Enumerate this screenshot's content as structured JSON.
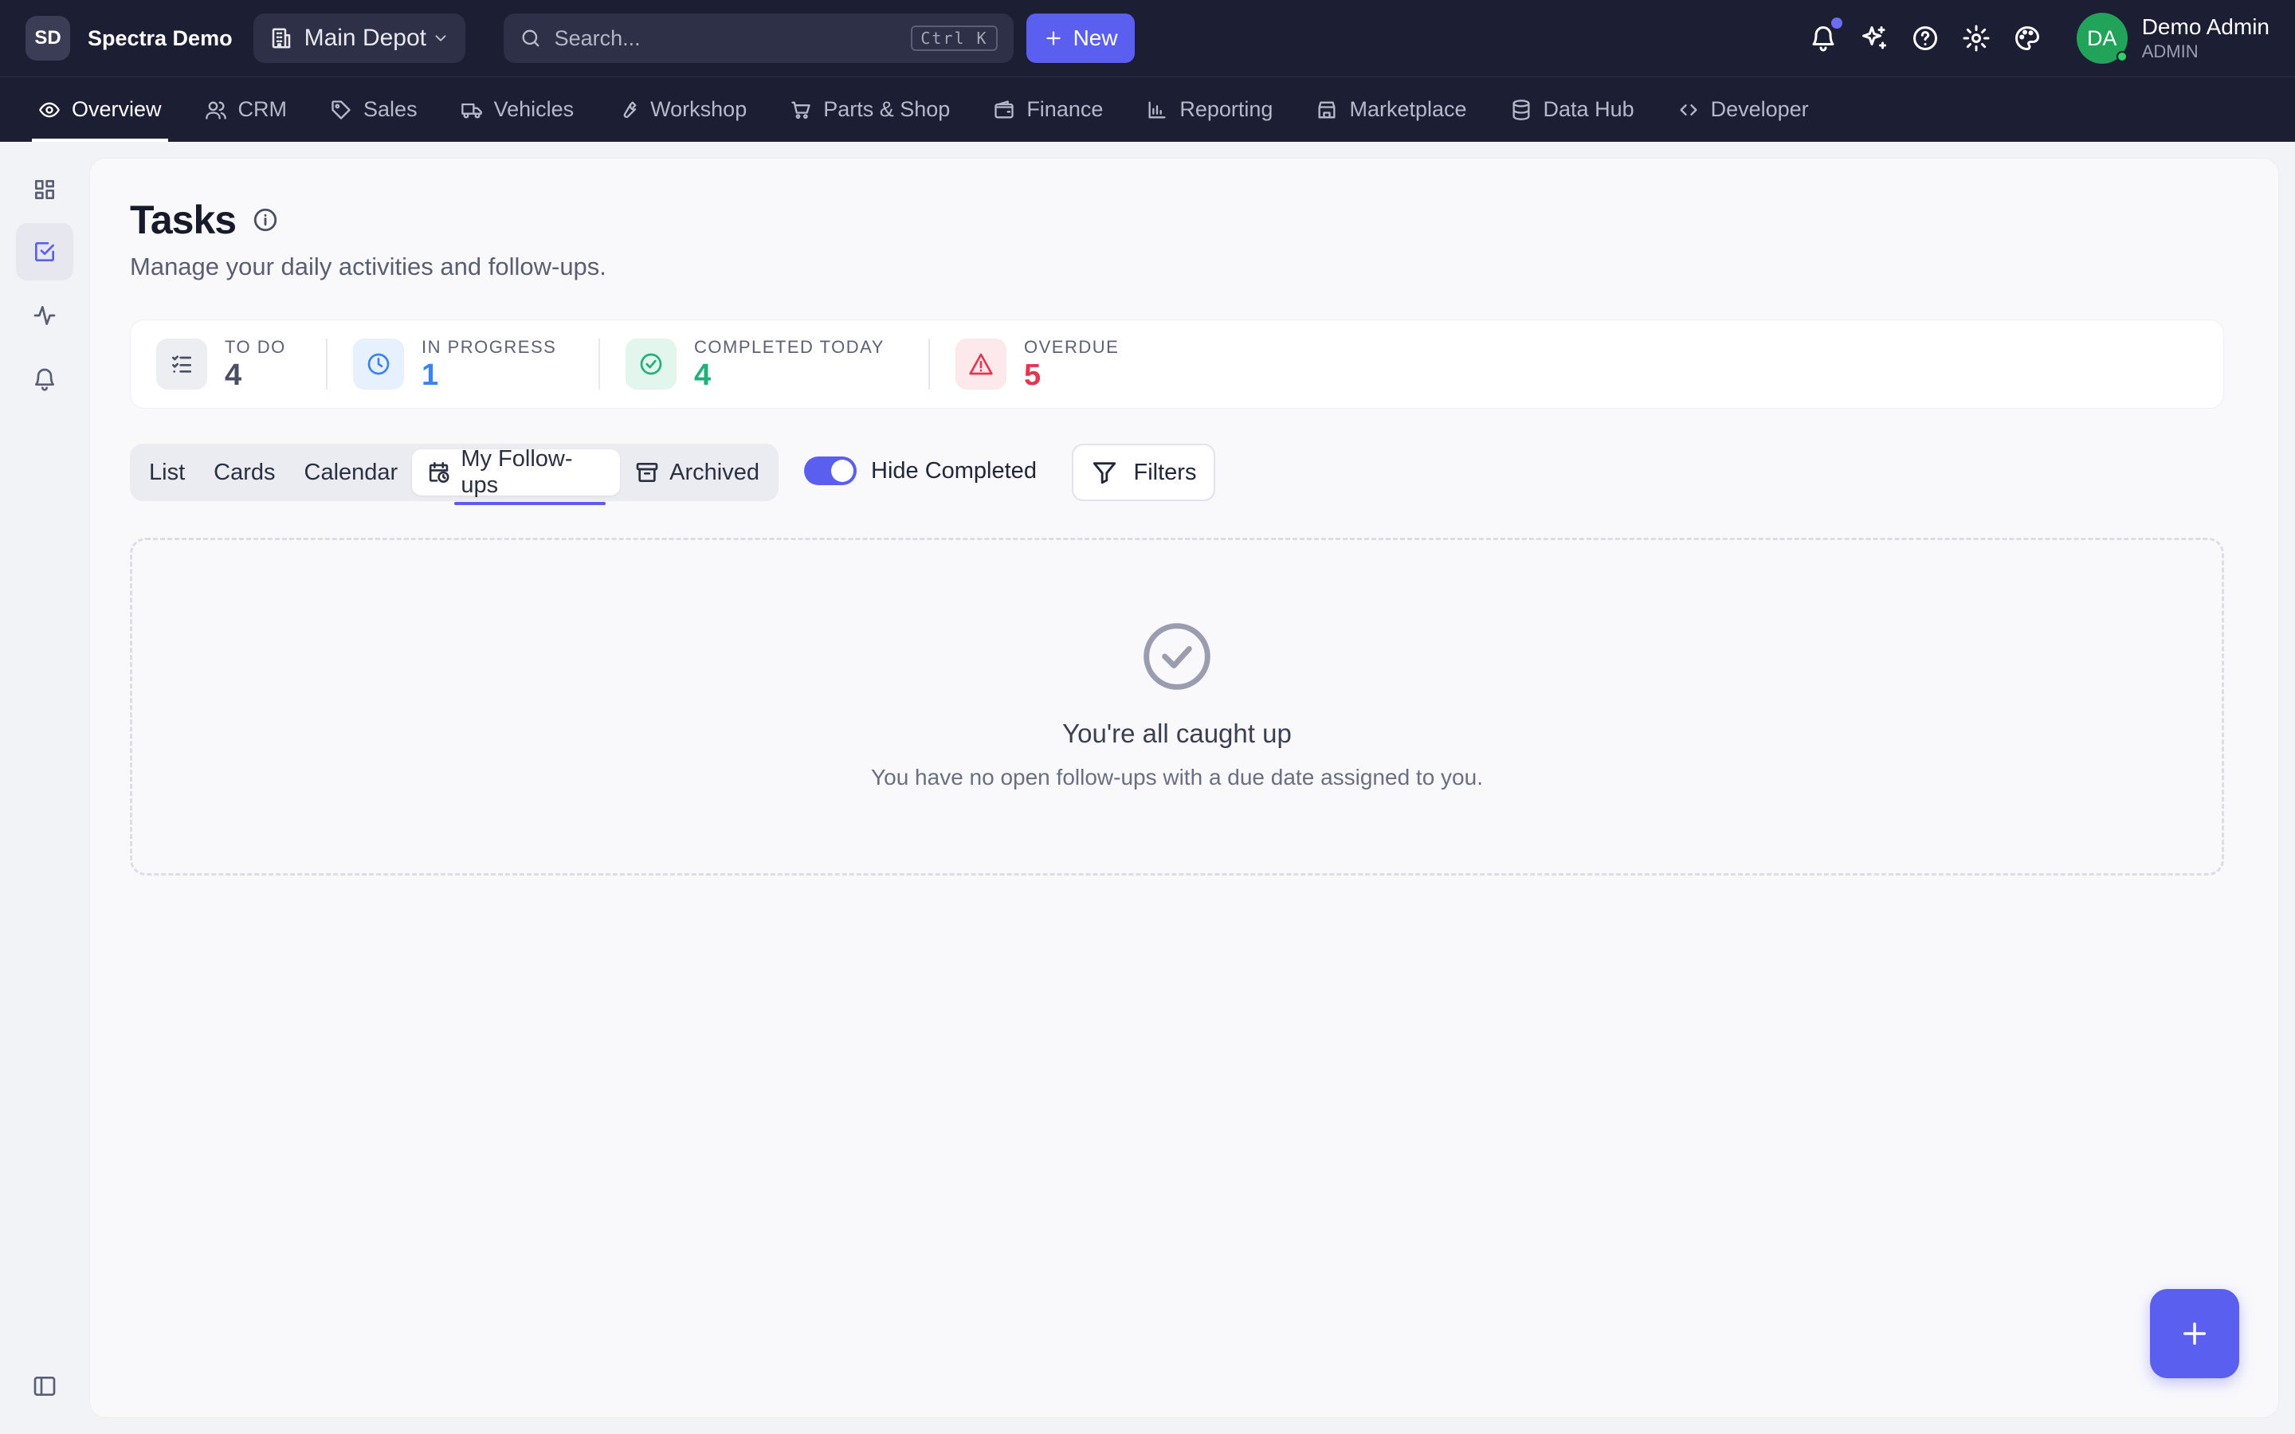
{
  "app": {
    "brand_initials": "SD",
    "brand_name": "Spectra Demo",
    "location": "Main Depot",
    "search_placeholder": "Search...",
    "search_shortcut": "Ctrl K",
    "new_label": "New"
  },
  "user": {
    "initials": "DA",
    "name": "Demo Admin",
    "role": "ADMIN"
  },
  "nav": {
    "items": [
      {
        "label": "Overview",
        "icon": "eye-icon",
        "active": true
      },
      {
        "label": "CRM",
        "icon": "users-icon"
      },
      {
        "label": "Sales",
        "icon": "tag-icon"
      },
      {
        "label": "Vehicles",
        "icon": "truck-icon"
      },
      {
        "label": "Workshop",
        "icon": "wrench-icon"
      },
      {
        "label": "Parts & Shop",
        "icon": "cart-icon"
      },
      {
        "label": "Finance",
        "icon": "wallet-icon"
      },
      {
        "label": "Reporting",
        "icon": "bar-chart-icon"
      },
      {
        "label": "Marketplace",
        "icon": "store-icon"
      },
      {
        "label": "Data Hub",
        "icon": "database-icon"
      },
      {
        "label": "Developer",
        "icon": "code-icon"
      }
    ]
  },
  "page": {
    "title": "Tasks",
    "subtitle": "Manage your daily activities and follow-ups."
  },
  "stats": [
    {
      "label": "TO DO",
      "value": "4",
      "color": "#4a4e63",
      "bg": "#eceef2",
      "icon": "list-check-icon"
    },
    {
      "label": "IN PROGRESS",
      "value": "1",
      "color": "#3b82f6",
      "bg": "#e7f0fd",
      "icon": "clock-icon"
    },
    {
      "label": "COMPLETED TODAY",
      "value": "4",
      "color": "#22b07a",
      "bg": "#e3f6ee",
      "icon": "check-circle-icon"
    },
    {
      "label": "OVERDUE",
      "value": "5",
      "color": "#e5364f",
      "bg": "#fde8eb",
      "icon": "alert-triangle-icon"
    }
  ],
  "view_tabs": {
    "list": "List",
    "cards": "Cards",
    "calendar": "Calendar",
    "followups": "My Follow-ups",
    "archived": "Archived",
    "selected": "My Follow-ups"
  },
  "hide_completed": {
    "label": "Hide Completed",
    "on": true
  },
  "filters_label": "Filters",
  "empty_state": {
    "title": "You're all caught up",
    "message": "You have no open follow-ups with a due date assigned to you."
  },
  "colors": {
    "accent": "#5b5ff0",
    "topbar": "#1c1e33",
    "avatar": "#22a35a"
  }
}
